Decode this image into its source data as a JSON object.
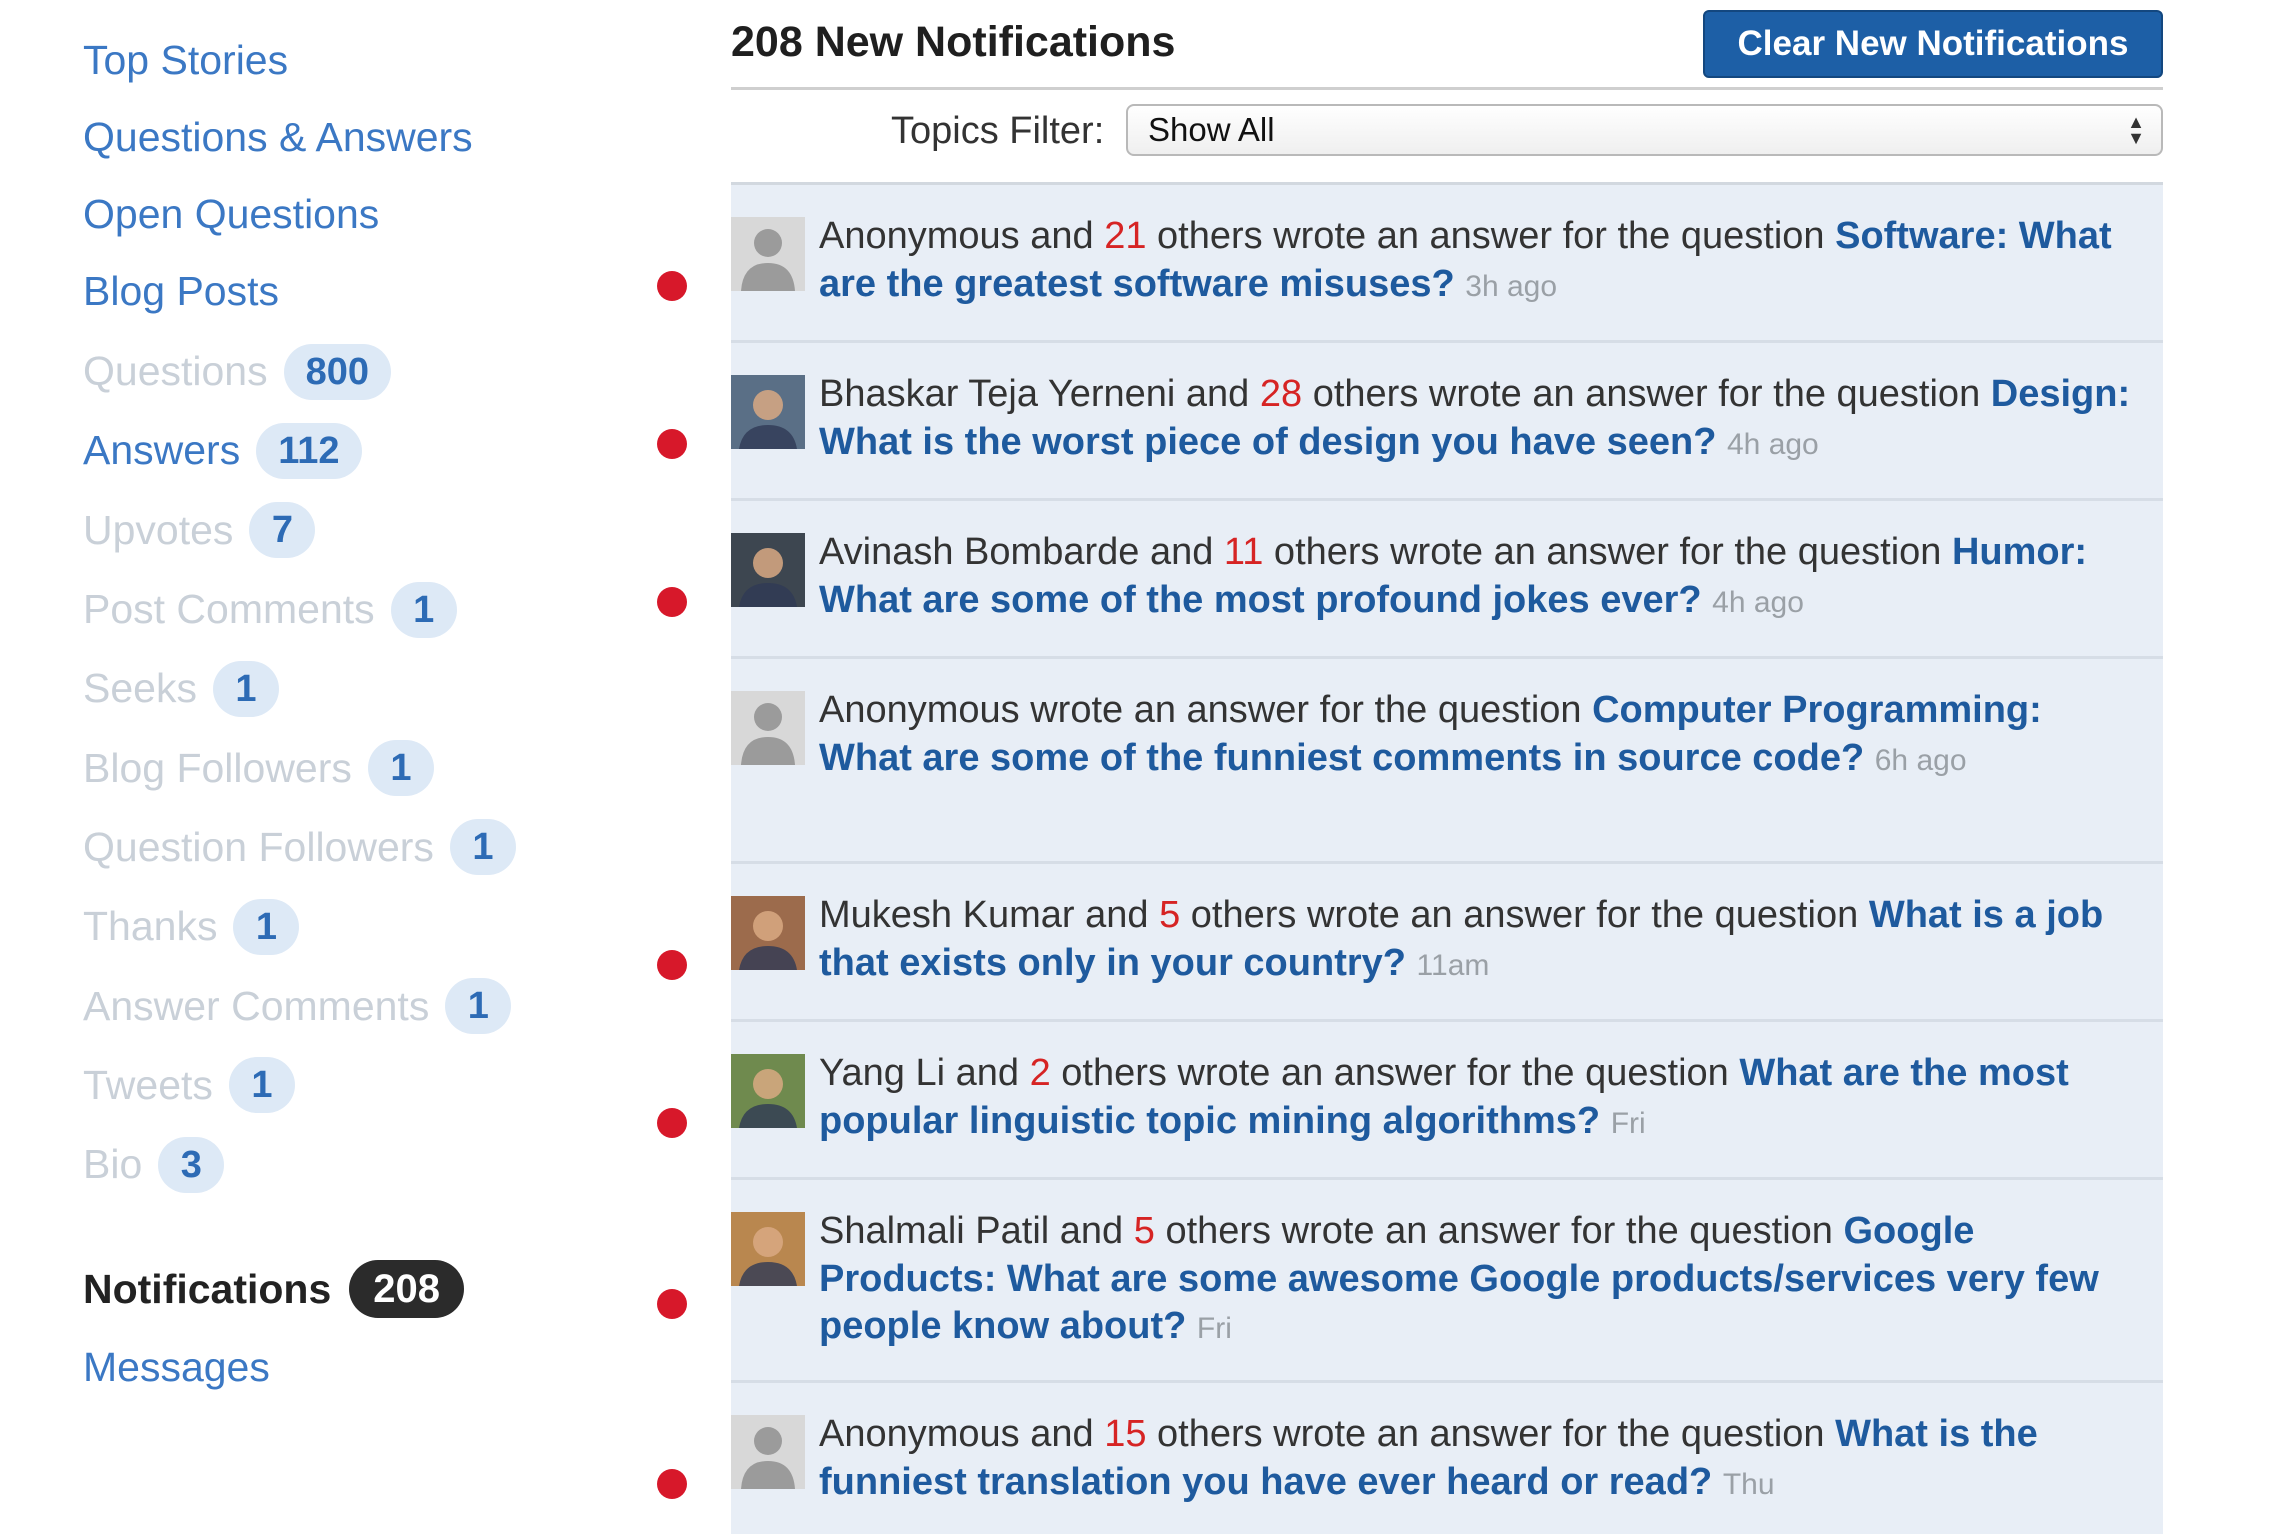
{
  "sidebar": {
    "links": [
      {
        "label": "Top Stories"
      },
      {
        "label": "Questions & Answers"
      },
      {
        "label": "Open Questions"
      },
      {
        "label": "Blog Posts"
      }
    ],
    "stats": [
      {
        "label": "Questions",
        "count": "800",
        "active": false
      },
      {
        "label": "Answers",
        "count": "112",
        "active": true
      },
      {
        "label": "Upvotes",
        "count": "7",
        "active": false
      },
      {
        "label": "Post Comments",
        "count": "1",
        "active": false
      },
      {
        "label": "Seeks",
        "count": "1",
        "active": false
      },
      {
        "label": "Blog Followers",
        "count": "1",
        "active": false
      },
      {
        "label": "Question Followers",
        "count": "1",
        "active": false
      },
      {
        "label": "Thanks",
        "count": "1",
        "active": false
      },
      {
        "label": "Answer Comments",
        "count": "1",
        "active": false
      },
      {
        "label": "Tweets",
        "count": "1",
        "active": false
      },
      {
        "label": "Bio",
        "count": "3",
        "active": false
      }
    ],
    "notifications": {
      "label": "Notifications",
      "count": "208"
    },
    "messages": {
      "label": "Messages"
    }
  },
  "header": {
    "title": "208 New Notifications",
    "clear_button": "Clear New Notifications"
  },
  "filter": {
    "label": "Topics Filter:",
    "selected": "Show All"
  },
  "notifications": [
    {
      "unread": true,
      "avatar": "silhouette",
      "name": "Anonymous",
      "and": " and ",
      "others": "21",
      "mid": " others wrote an answer for the question ",
      "question": "Software: What are the greatest software misuses?",
      "time": "3h ago"
    },
    {
      "unread": true,
      "avatar": "photo-blue",
      "name": "Bhaskar Teja Yerneni",
      "and": " and ",
      "others": "28",
      "mid": " others wrote an answer for the question ",
      "question": "Design: What is the worst piece of design you have seen?",
      "time": "4h ago"
    },
    {
      "unread": true,
      "avatar": "photo-dark",
      "name": "Avinash Bombarde",
      "and": " and ",
      "others": "11",
      "mid": " others wrote an answer for the question ",
      "question": "Humor: What are some of the most profound jokes ever?",
      "time": "4h ago"
    },
    {
      "unread": false,
      "avatar": "silhouette",
      "name": "Anonymous",
      "and": "",
      "others": "",
      "mid": " wrote an answer for the question ",
      "question": "Computer Programming: What are some of the funniest comments in source code?",
      "time": "6h ago"
    },
    {
      "unread": true,
      "avatar": "photo-face",
      "name": "Mukesh Kumar",
      "and": " and ",
      "others": "5",
      "mid": " others wrote an answer for the question ",
      "question": "What is a job that exists only in your country?",
      "time": "11am"
    },
    {
      "unread": true,
      "avatar": "photo-green",
      "name": "Yang Li",
      "and": " and ",
      "others": "2",
      "mid": " others wrote an answer for the question ",
      "question": "What are the most popular linguistic topic mining algorithms?",
      "time": "Fri"
    },
    {
      "unread": true,
      "avatar": "photo-warm",
      "name": "Shalmali Patil",
      "and": " and ",
      "others": "5",
      "mid": " others wrote an answer for the question ",
      "question": "Google Products: What are some awesome Google products/services very few people know about?",
      "time": "Fri"
    },
    {
      "unread": true,
      "avatar": "silhouette",
      "name": "Anonymous",
      "and": " and ",
      "others": "15",
      "mid": " others wrote an answer for the question ",
      "question": "What is the funniest translation you have ever heard or read?",
      "time": "Thu"
    }
  ],
  "colors": {
    "link": "#3b78c4",
    "question": "#1e5a9e",
    "count_red": "#d62424",
    "unread_dot": "#d7182a",
    "item_bg": "#e8eef6",
    "button_bg": "#1d5fa6"
  }
}
